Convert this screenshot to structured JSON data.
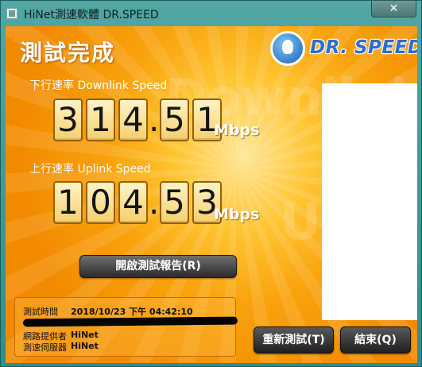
{
  "window": {
    "title": "HiNet測速軟體 DR.SPEED",
    "close_glyph": "✕"
  },
  "header": {
    "title": "測試完成",
    "logo_text": "DR. SPEED"
  },
  "background": {
    "watermark_down": "Downlink",
    "watermark_up": "Uplink"
  },
  "downlink": {
    "label": "下行速率 Downlink Speed",
    "digits": [
      "3",
      "1",
      "4",
      "5",
      "1"
    ],
    "decimal_point": ".",
    "value": "314.51",
    "unit": "Mbps"
  },
  "uplink": {
    "label": "上行速率 Uplink Speed",
    "digits": [
      "1",
      "0",
      "4",
      "5",
      "3"
    ],
    "decimal_point": ".",
    "value": "104.53",
    "unit": "Mbps"
  },
  "report_button": "開啟測試報告(R)",
  "info": {
    "time_label": "測試時間",
    "time_value": "2018/10/23 下午 04:42:10",
    "isp_label": "網路提供者",
    "isp_value": "HiNet",
    "server_label": "測速伺服器",
    "server_value": "HiNet"
  },
  "buttons": {
    "retest": "重新測試(T)",
    "exit": "結束(Q)"
  },
  "colors": {
    "accent_orange": "#f9a20c",
    "titlebar_teal": "#3f9794",
    "logo_blue": "#2b6dd1"
  }
}
